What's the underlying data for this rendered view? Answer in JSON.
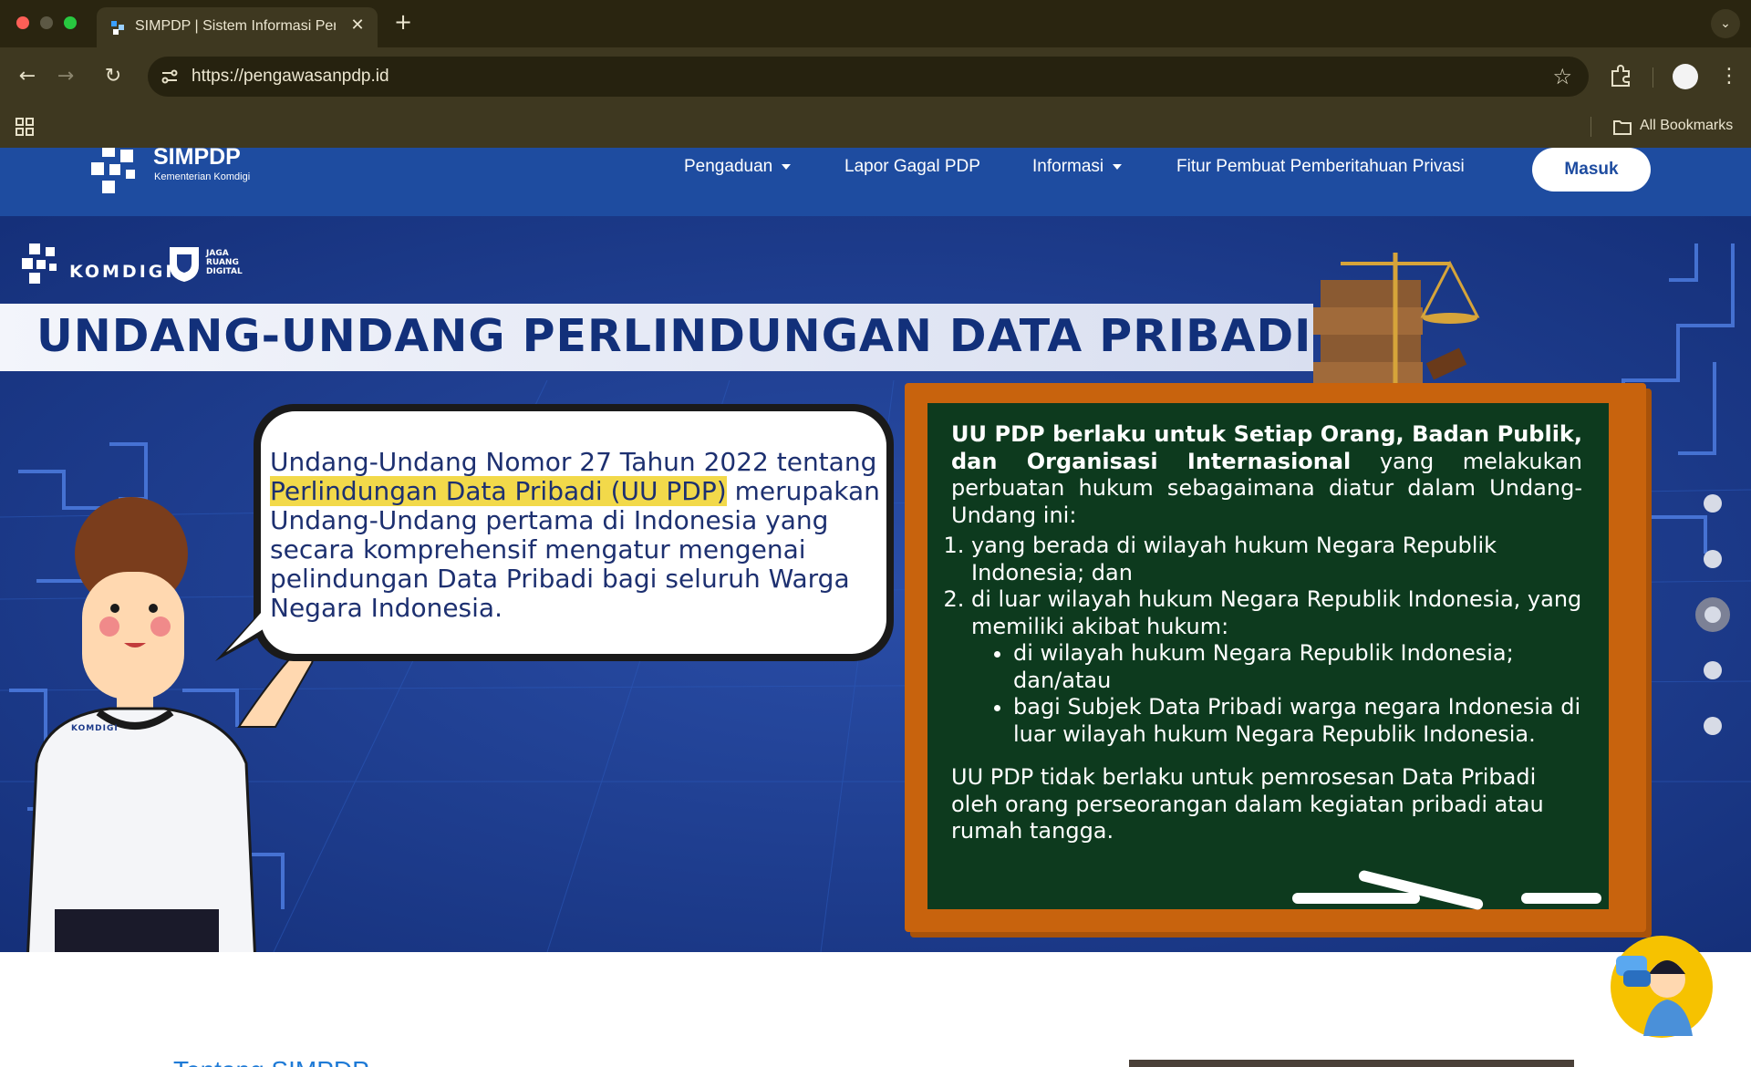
{
  "browser": {
    "tab_title": "SIMPDP | Sistem Informasi Pengawasan PDP",
    "url": "https://pengawasanpdp.id",
    "bookmarks_label": "All Bookmarks",
    "icons": [
      "back-icon",
      "forward-icon",
      "reload-icon",
      "site-info-icon",
      "star-icon",
      "extensions-icon",
      "profile-icon",
      "menu-icon",
      "apps-icon",
      "folder-icon"
    ]
  },
  "site": {
    "logo_title": "SIMPDP",
    "logo_sub": "Kementerian Komdigi",
    "nav": [
      {
        "label": "Pengaduan",
        "dropdown": true
      },
      {
        "label": "Lapor Gagal PDP",
        "dropdown": false
      },
      {
        "label": "Informasi",
        "dropdown": true
      },
      {
        "label": "Fitur Pembuat Pemberitahuan Privasi",
        "dropdown": false
      }
    ],
    "login_label": "Masuk",
    "brand_color": "#1e4ca0"
  },
  "hero": {
    "komdigi": "KOMDIGI",
    "jrd_text": "JAGA RUANG DIGITAL",
    "title": "UNDANG-UNDANG PERLINDUNGAN DATA PRIBADI",
    "mascot_badge": "KOMDIGI",
    "speech": {
      "before": "Undang-Undang Nomor 27 Tahun 2022 tentang ",
      "highlight": "Perlindungan Data Pribadi (UU PDP)",
      "after": " merupakan Undang-Undang pertama di Indonesia yang secara komprehensif mengatur mengenai pelindungan Data Pribadi bagi seluruh Warga Negara Indonesia."
    },
    "board": {
      "lead_bold": "UU PDP berlaku untuk Setiap Orang, Badan Publik, dan Organisasi Internasional",
      "lead_rest": " yang melakukan perbuatan hukum sebagaimana diatur dalam Undang-Undang ini:",
      "items": [
        "yang berada di wilayah hukum Negara Republik Indonesia; dan",
        "di luar wilayah hukum Negara Republik Indonesia, yang memiliki akibat hukum:"
      ],
      "subitems": [
        "di wilayah hukum Negara Republik Indonesia; dan/atau",
        "bagi Subjek Data Pribadi warga negara Indonesia di luar wilayah hukum Negara Republik Indonesia."
      ],
      "tail": "UU PDP tidak berlaku untuk pemrosesan Data Pribadi oleh orang perseorangan dalam kegiatan pribadi atau rumah tangga."
    },
    "slides": {
      "count": 5,
      "active": 3
    }
  },
  "below": {
    "heading": "Tentang SIMPDP"
  }
}
